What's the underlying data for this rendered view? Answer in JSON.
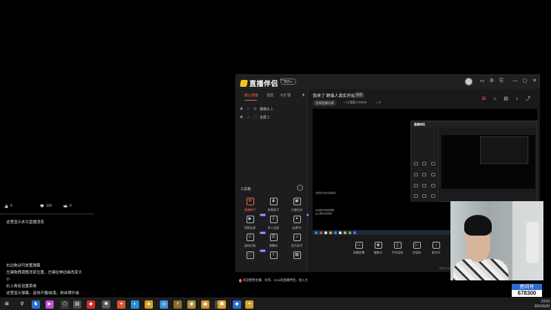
{
  "chat_overlay": {
    "stats": [
      {
        "icon": "thumb-icon",
        "value": "0"
      },
      {
        "icon": "heart-icon",
        "value": "120"
      },
      {
        "icon": "crown-icon",
        "value": "0"
      }
    ],
    "top_message": "这里显示本次直播消息",
    "bottom_messages": [
      "右边拖动可放置弹幕",
      "左键拖拽调整改变位置，左键拉伸边缘改变大",
      "小",
      "右上角有设置菜单",
      "这里显示弹幕，音效开播/结束，粉丝牌升级"
    ]
  },
  "app": {
    "logo_text": "直播伴侣",
    "logo_sup": "PC",
    "update_label": "更新 ▸",
    "window_controls": [
      "▭",
      "⚙",
      "⎘",
      "—",
      "▢",
      "✕"
    ],
    "tabs": [
      "默认场景",
      "竖屏",
      "可扩展"
    ],
    "tab_add": "+",
    "sources": [
      {
        "kind": "◎",
        "name": "摄像头 1"
      },
      {
        "kind": "⛶",
        "name": "全屏 1"
      }
    ],
    "tools_title": "工具箱",
    "tools_more": "···",
    "tools": [
      {
        "label": "直播助手",
        "icon": "⚒",
        "hot": true,
        "badge": ""
      },
      {
        "label": "房管助手",
        "icon": "♟",
        "hot": false,
        "badge": ""
      },
      {
        "label": "主播任务",
        "icon": "▣",
        "hot": false,
        "badge": ""
      },
      {
        "label": "视频连麦",
        "icon": "▶",
        "hot": false,
        "badge": "NEW"
      },
      {
        "label": "多人连麦",
        "icon": "⇩",
        "hot": false,
        "badge": ""
      },
      {
        "label": "连麦PK",
        "icon": "✦",
        "hot": false,
        "badge": "NEW"
      },
      {
        "label": "虚拟形象",
        "icon": "☺",
        "hot": false,
        "badge": "NEW"
      },
      {
        "label": "弹幕机",
        "icon": "☰",
        "hot": false,
        "badge": ""
      },
      {
        "label": "音乐助手",
        "icon": "♫",
        "hot": false,
        "badge": ""
      },
      {
        "label": "",
        "icon": "⬚",
        "hot": false,
        "badge": "NEW"
      },
      {
        "label": "",
        "icon": "⇪",
        "hot": false,
        "badge": ""
      },
      {
        "label": "",
        "icon": "▦",
        "hot": false,
        "badge": ""
      }
    ],
    "notice": "欢迎使用主播、抖音、火山的直播伴侣，进入大屏模式与观众互动"
  },
  "content": {
    "stream_title": "我来了 野蛮人真实开局",
    "edit_label": "修改",
    "category": "选择直播分类",
    "room_info": "一心电脑  678300",
    "likes": "0",
    "header_icons": [
      {
        "name": "gift-icon",
        "glyph": "⊞",
        "red": true
      },
      {
        "name": "lock-icon",
        "glyph": "⌂",
        "red": false
      },
      {
        "name": "screen-icon",
        "glyph": "▤",
        "red": false
      },
      {
        "name": "bell-icon",
        "glyph": "♪",
        "red": false
      },
      {
        "name": "share-icon",
        "glyph": "⤴",
        "red": false
      }
    ],
    "nested_logo": "直播伴侣",
    "mini_chat": [
      "这里显示本次直播消息",
      "",
      "",
      "",
      "",
      "右边拖动可放置弹幕",
      "右上角有设置菜单"
    ],
    "bottom_tools": [
      {
        "label": "直播屏幕",
        "glyph": "▭"
      },
      {
        "label": "摄像头",
        "glyph": "◉"
      },
      {
        "label": "手机投屏",
        "glyph": "▯"
      },
      {
        "label": "多媒体",
        "glyph": "▷"
      },
      {
        "label": "麦克风",
        "glyph": "♪"
      }
    ],
    "cpu_text": "CPU 12% 内存 ..."
  },
  "room_badge": {
    "label": "房间号",
    "number": "678300"
  },
  "taskbar": {
    "time": "23:53",
    "date": "2021/6/30",
    "icons": [
      {
        "glyph": "⊞",
        "color": "#1c1c1c"
      },
      {
        "glyph": "⚲",
        "color": "#1c1c1c"
      },
      {
        "glyph": "♞",
        "color": "#2b6cd1"
      },
      {
        "glyph": "▶",
        "color": "#c44bd6"
      },
      {
        "glyph": "⬡",
        "color": "#3a3a3a"
      },
      {
        "glyph": "▤",
        "color": "#4a4a4a"
      },
      {
        "glyph": "◆",
        "color": "#d12b2b"
      },
      {
        "glyph": "✺",
        "color": "#5a5a5a"
      },
      {
        "glyph": "✦",
        "color": "#d9552b"
      },
      {
        "glyph": "◐",
        "color": "#2b8fd1"
      },
      {
        "glyph": "◈",
        "color": "#d1a02b"
      },
      {
        "glyph": "◎",
        "color": "#3a8fd1"
      },
      {
        "glyph": "⚡",
        "color": "#8f6b2b"
      },
      {
        "glyph": "◉",
        "color": "#a58f3a"
      },
      {
        "glyph": "▣",
        "color": "#d18f2b"
      },
      {
        "glyph": "✿",
        "color": "#4a4a4a"
      },
      {
        "glyph": "⬢",
        "color": "#e0a030"
      },
      {
        "glyph": "◆",
        "color": "#2b6cd1"
      },
      {
        "glyph": "☀",
        "color": "#d1a02b"
      }
    ]
  }
}
